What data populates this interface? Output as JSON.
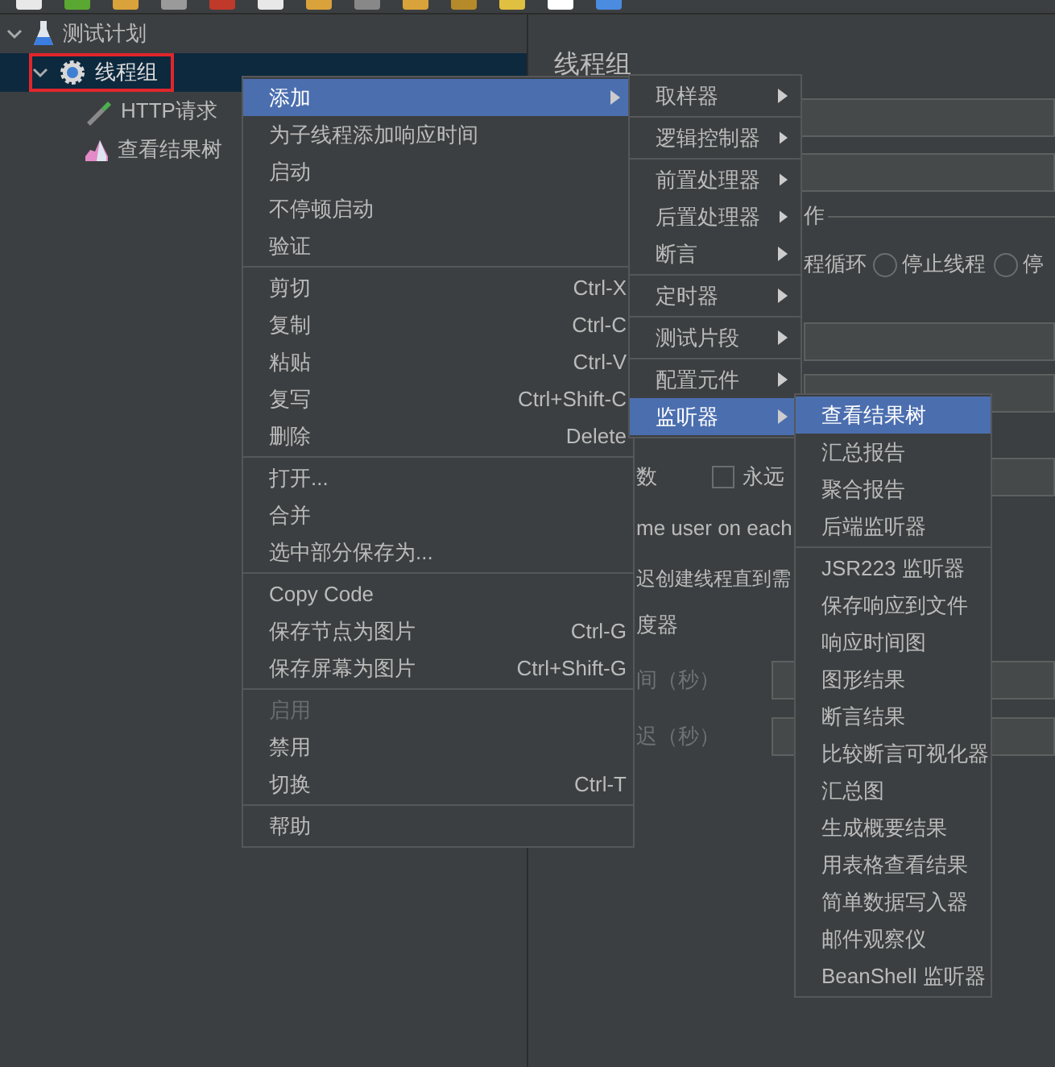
{
  "tree": [
    {
      "label": "测试计划",
      "kind": "test_plan",
      "expanded": true,
      "selected": false,
      "children": [
        {
          "label": "线程组",
          "kind": "thread_group",
          "expanded": true,
          "selected": true,
          "highlighted": true,
          "children": [
            {
              "label": "HTTP请求",
              "kind": "sampler"
            },
            {
              "label": "查看结果树",
              "kind": "listener"
            }
          ]
        }
      ]
    }
  ],
  "editor": {
    "title": "线程组",
    "section_label": "作",
    "option_text": "程循环",
    "radios": [
      {
        "label": "停止线程",
        "selected": false
      },
      {
        "label": "停",
        "selected": false
      }
    ],
    "loop_label": "数",
    "forever": {
      "label": "永远",
      "checked": false
    },
    "same_user_text": "me user on each",
    "delay_text": "迟创建线程直到需",
    "scheduler_text": "度器",
    "duration_label": {
      "text": "间（秒）",
      "disabled": true
    },
    "startup_delay_label": {
      "text": "迟（秒）",
      "disabled": true
    }
  },
  "context_menu": [
    [
      {
        "label": "添加",
        "submenu": true,
        "selected": true
      },
      {
        "label": "为子线程添加响应时间"
      },
      {
        "label": "启动"
      },
      {
        "label": "不停顿启动"
      },
      {
        "label": "验证"
      }
    ],
    [
      {
        "label": "剪切",
        "shortcut": "Ctrl-X"
      },
      {
        "label": "复制",
        "shortcut": "Ctrl-C"
      },
      {
        "label": "粘贴",
        "shortcut": "Ctrl-V"
      },
      {
        "label": "复写",
        "shortcut": "Ctrl+Shift-C"
      },
      {
        "label": "删除",
        "shortcut": "Delete"
      }
    ],
    [
      {
        "label": "打开..."
      },
      {
        "label": "合并"
      },
      {
        "label": "选中部分保存为..."
      }
    ],
    [
      {
        "label": "Copy Code"
      },
      {
        "label": "保存节点为图片",
        "shortcut": "Ctrl-G"
      },
      {
        "label": "保存屏幕为图片",
        "shortcut": "Ctrl+Shift-G"
      }
    ],
    [
      {
        "label": "启用",
        "disabled": true
      },
      {
        "label": "禁用"
      },
      {
        "label": "切换",
        "shortcut": "Ctrl-T"
      }
    ],
    [
      {
        "label": "帮助"
      }
    ]
  ],
  "add_submenu": [
    [
      {
        "label": "取样器",
        "submenu": true
      }
    ],
    [
      {
        "label": "逻辑控制器",
        "submenu": true
      }
    ],
    [
      {
        "label": "前置处理器",
        "submenu": true
      },
      {
        "label": "后置处理器",
        "submenu": true
      },
      {
        "label": "断言",
        "submenu": true
      }
    ],
    [
      {
        "label": "定时器",
        "submenu": true
      }
    ],
    [
      {
        "label": "测试片段",
        "submenu": true
      }
    ],
    [
      {
        "label": "配置元件",
        "submenu": true
      },
      {
        "label": "监听器",
        "submenu": true,
        "selected": true
      }
    ]
  ],
  "listener_submenu": [
    [
      {
        "label": "查看结果树",
        "selected": true
      },
      {
        "label": "汇总报告"
      },
      {
        "label": "聚合报告"
      },
      {
        "label": "后端监听器"
      }
    ],
    [
      {
        "label": "JSR223 监听器"
      },
      {
        "label": "保存响应到文件"
      },
      {
        "label": "响应时间图"
      },
      {
        "label": "图形结果"
      },
      {
        "label": "断言结果"
      },
      {
        "label": "比较断言可视化器"
      },
      {
        "label": "汇总图"
      },
      {
        "label": "生成概要结果"
      },
      {
        "label": "用表格查看结果"
      },
      {
        "label": "简单数据写入器"
      },
      {
        "label": "邮件观察仪"
      },
      {
        "label": "BeanShell 监听器"
      }
    ]
  ]
}
